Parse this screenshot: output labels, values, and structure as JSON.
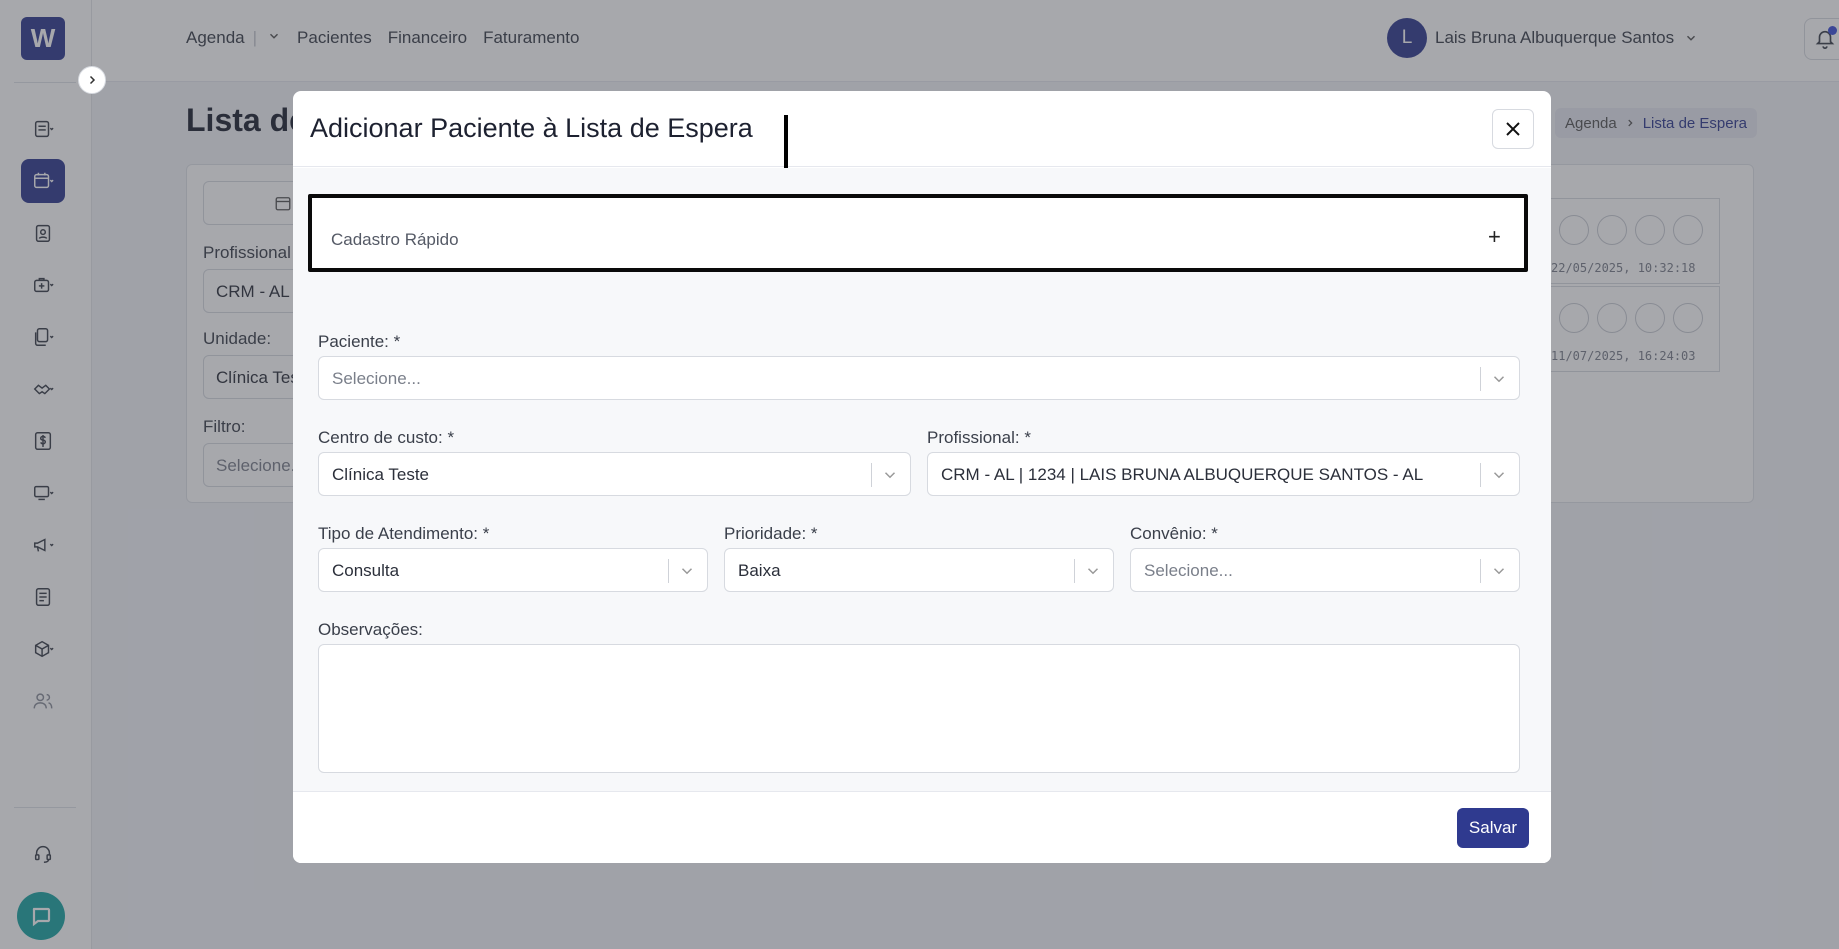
{
  "sidebar": {
    "logo_text": "W",
    "icons": [
      "list-icon",
      "calendar-icon",
      "clipboard-icon",
      "medical-bag-icon",
      "documents-icon",
      "handshake-icon",
      "dollar-icon",
      "monitor-icon",
      "megaphone-icon",
      "notes-icon",
      "box-icon",
      "users-icon",
      "headset-icon",
      "chat-icon"
    ]
  },
  "topbar": {
    "nav": {
      "agenda": "Agenda",
      "separator": "|",
      "pacientes": "Pacientes",
      "financeiro": "Financeiro",
      "faturamento": "Faturamento"
    },
    "user": {
      "initial": "L",
      "name": "Lais Bruna Albuquerque Santos"
    }
  },
  "page": {
    "title": "Lista de",
    "breadcrumb": {
      "parent": "Agenda",
      "current": "Lista de Espera"
    },
    "background_form": {
      "profissional_label": "Profissional",
      "profissional_value": "CRM - AL",
      "unidade_label": "Unidade:",
      "unidade_value": "Clínica Tes",
      "filtro_label": "Filtro:",
      "filtro_placeholder": "Selecione."
    },
    "background_rows": [
      {
        "date": "22/05/2025, 10:32:18"
      },
      {
        "date": "11/07/2025, 16:24:03"
      }
    ]
  },
  "modal": {
    "title": "Adicionar Paciente à Lista de Espera",
    "cadastro_rapido": "Cadastro Rápido",
    "plus_symbol": "+",
    "paciente": {
      "label": "Paciente: *",
      "placeholder": "Selecione..."
    },
    "centro_custo": {
      "label": "Centro de custo: *",
      "value": "Clínica Teste"
    },
    "profissional": {
      "label": "Profissional: *",
      "value": "CRM - AL | 1234 | LAIS BRUNA ALBUQUERQUE SANTOS - AL"
    },
    "tipo_atendimento": {
      "label": "Tipo de Atendimento: *",
      "value": "Consulta"
    },
    "prioridade": {
      "label": "Prioridade: *",
      "value": "Baixa"
    },
    "convenio": {
      "label": "Convênio: *",
      "placeholder": "Selecione..."
    },
    "observacoes": {
      "label": "Observações:"
    },
    "save_label": "Salvar"
  },
  "colors": {
    "brand": "#2f3a8f",
    "chat": "#1aa5a3",
    "highlight_border": "#0a0a0a"
  }
}
